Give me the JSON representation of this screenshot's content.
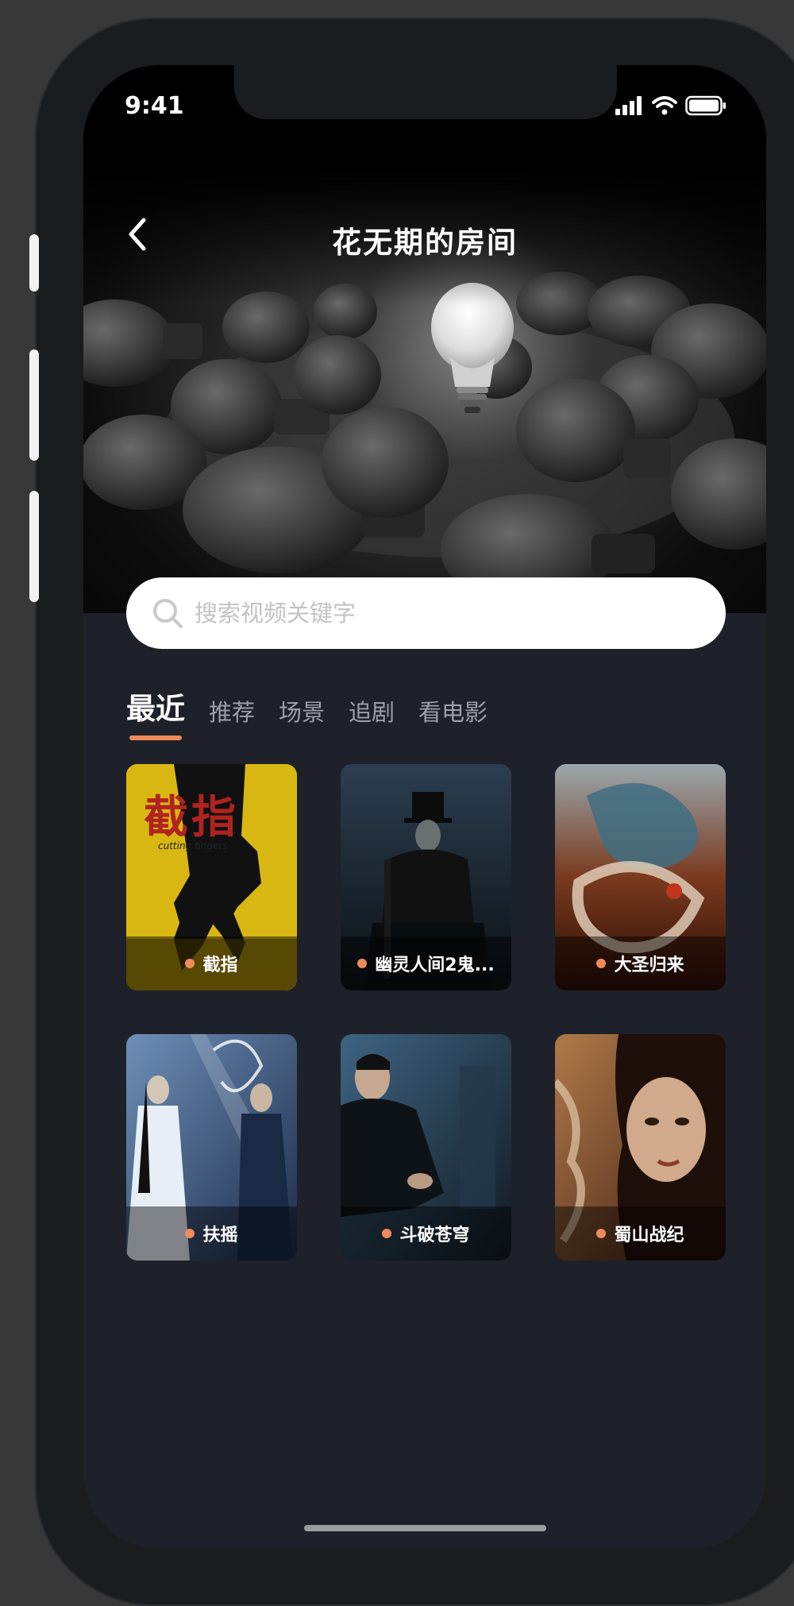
{
  "status_bar": {
    "time": "9:41"
  },
  "header": {
    "title": "花无期的房间"
  },
  "search": {
    "placeholder": "搜索视频关键字"
  },
  "tabs": [
    {
      "label": "最近",
      "active": true
    },
    {
      "label": "推荐",
      "active": false
    },
    {
      "label": "场景",
      "active": false
    },
    {
      "label": "追剧",
      "active": false
    },
    {
      "label": "看电影",
      "active": false
    }
  ],
  "videos": [
    {
      "title": "截指",
      "poster_text": "截指",
      "poster_subtitle": "cutting fingers"
    },
    {
      "title": "幽灵人间2鬼..."
    },
    {
      "title": "大圣归来"
    },
    {
      "title": "扶摇"
    },
    {
      "title": "斗破苍穹"
    },
    {
      "title": "蜀山战纪"
    }
  ],
  "colors": {
    "accent": "#f08a5a",
    "background": "#1e212a",
    "tab_inactive": "#9aa0ab"
  }
}
